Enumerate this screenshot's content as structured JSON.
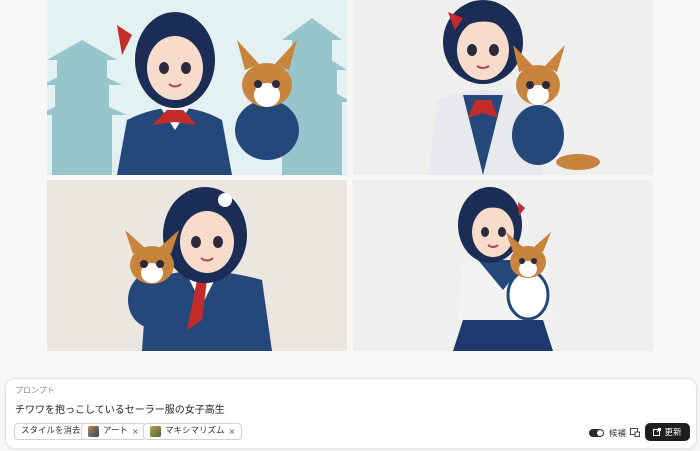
{
  "images": [
    {
      "name": "result-image-1"
    },
    {
      "name": "result-image-2"
    },
    {
      "name": "result-image-3"
    },
    {
      "name": "result-image-4"
    }
  ],
  "prompt": {
    "label": "プロンプト",
    "text": "チワワを抱っこしているセーラー服の女子高生"
  },
  "actions": {
    "clear_style": "スタイルを消去",
    "styles": [
      {
        "label": "アート",
        "remove": "×"
      },
      {
        "label": "マキシマリズム",
        "remove": "×"
      }
    ],
    "toggle_label": "候補",
    "refresh_label": "更新"
  },
  "colors": {
    "hair": "#1c2d55",
    "uniform": "#25487a",
    "ribbon": "#c42c2c",
    "dog": "#c8843c"
  }
}
